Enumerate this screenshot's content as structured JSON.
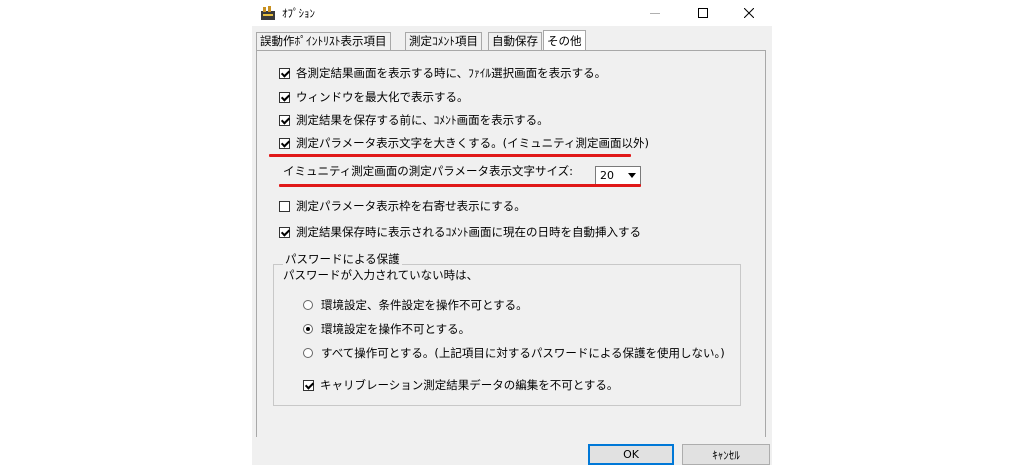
{
  "window": {
    "title": "ｵﾌﾟｼｮﾝ"
  },
  "tabs": [
    {
      "label": "誤動作ﾎﾟｲﾝﾄﾘｽﾄ表示項目",
      "active": false
    },
    {
      "label": "測定ｺﾒﾝﾄ項目",
      "active": false
    },
    {
      "label": "自動保存",
      "active": false
    },
    {
      "label": "その他",
      "active": true
    }
  ],
  "options": [
    {
      "label": "各測定結果画面を表示する時に、ﾌｧｲﾙ選択画面を表示する。",
      "checked": true
    },
    {
      "label": "ウィンドウを最大化で表示する。",
      "checked": true
    },
    {
      "label": "測定結果を保存する前に、ｺﾒﾝﾄ画面を表示する。",
      "checked": true
    },
    {
      "label": "測定パラメータ表示文字を大きくする。(イミュニティ測定画面以外)",
      "checked": true
    }
  ],
  "font_size": {
    "label": "イミュニティ測定画面の測定パラメータ表示文字サイズ:",
    "value": "20"
  },
  "options2": [
    {
      "label": "測定パラメータ表示枠を右寄せ表示にする。",
      "checked": false
    },
    {
      "label": "測定結果保存時に表示されるｺﾒﾝﾄ画面に現在の日時を自動挿入する",
      "checked": true
    }
  ],
  "password": {
    "title": "パスワードによる保護",
    "subtitle": "パスワードが入力されていない時は、",
    "radios": [
      {
        "label": "環境設定、条件設定を操作不可とする。",
        "selected": false
      },
      {
        "label": "環境設定を操作不可とする。",
        "selected": true
      },
      {
        "label": "すべて操作可とする。(上記項目に対するパスワードによる保護を使用しない。)",
        "selected": false
      }
    ],
    "calibration": {
      "label": "キャリブレーション測定結果データの編集を不可とする。",
      "checked": true
    }
  },
  "buttons": {
    "ok": "OK",
    "cancel": "ｷｬﾝｾﾙ"
  },
  "colors": {
    "accent": "#0078d7",
    "highlight": "#e01818"
  }
}
